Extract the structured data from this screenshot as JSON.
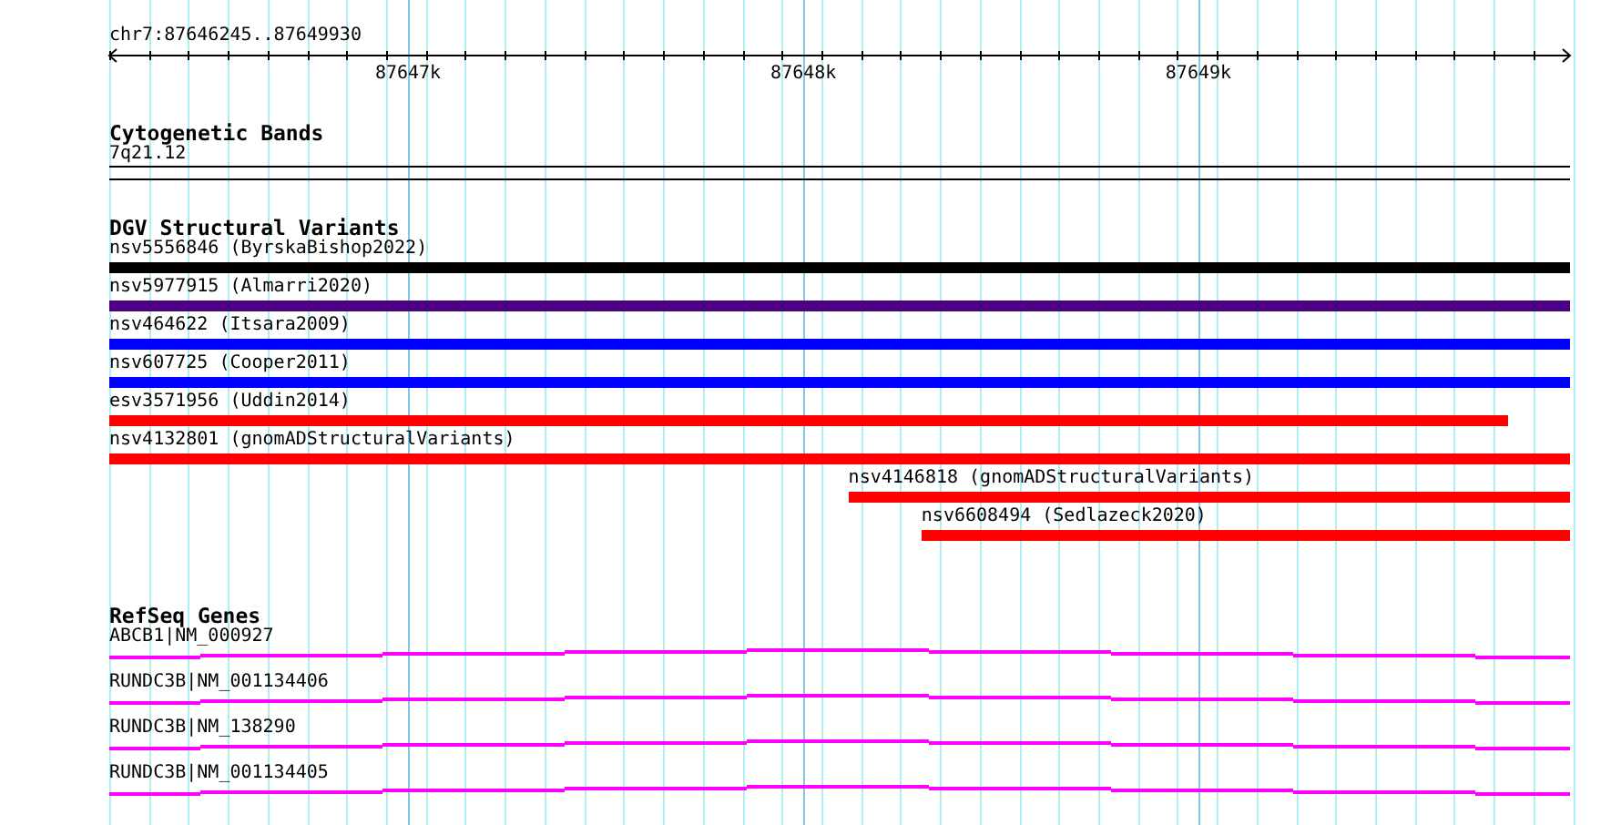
{
  "ruler": {
    "region": "chr7:87646245..87649930",
    "tick_labels": [
      "87647k",
      "87648k",
      "87649k"
    ]
  },
  "tracks": [
    {
      "kind": "bands",
      "title": "Cytogenetic Bands",
      "items": [
        {
          "label": "7q21.12"
        }
      ]
    },
    {
      "kind": "variants",
      "title": "DGV Structural Variants",
      "items": [
        {
          "label": "nsv5556846 (ByrskaBishop2022)",
          "color": "#000000"
        },
        {
          "label": "nsv5977915 (Almarri2020)",
          "color": "#4b0082"
        },
        {
          "label": "nsv464622 (Itsara2009)",
          "color": "#0000ff"
        },
        {
          "label": "nsv607725 (Cooper2011)",
          "color": "#0000ff"
        },
        {
          "label": "esv3571956 (Uddin2014)",
          "color": "#ff0000"
        },
        {
          "label": "nsv4132801 (gnomADStructuralVariants)",
          "color": "#ff0000"
        },
        {
          "label": "nsv4146818 (gnomADStructuralVariants)",
          "color": "#ff0000"
        },
        {
          "label": "nsv6608494 (Sedlazeck2020)",
          "color": "#ff0000"
        }
      ]
    },
    {
      "kind": "genes",
      "title": "RefSeq Genes",
      "items": [
        {
          "label": "ABCB1|NM_000927"
        },
        {
          "label": "RUNDC3B|NM_001134406"
        },
        {
          "label": "RUNDC3B|NM_138290"
        },
        {
          "label": "RUNDC3B|NM_001134405"
        }
      ]
    }
  ]
}
